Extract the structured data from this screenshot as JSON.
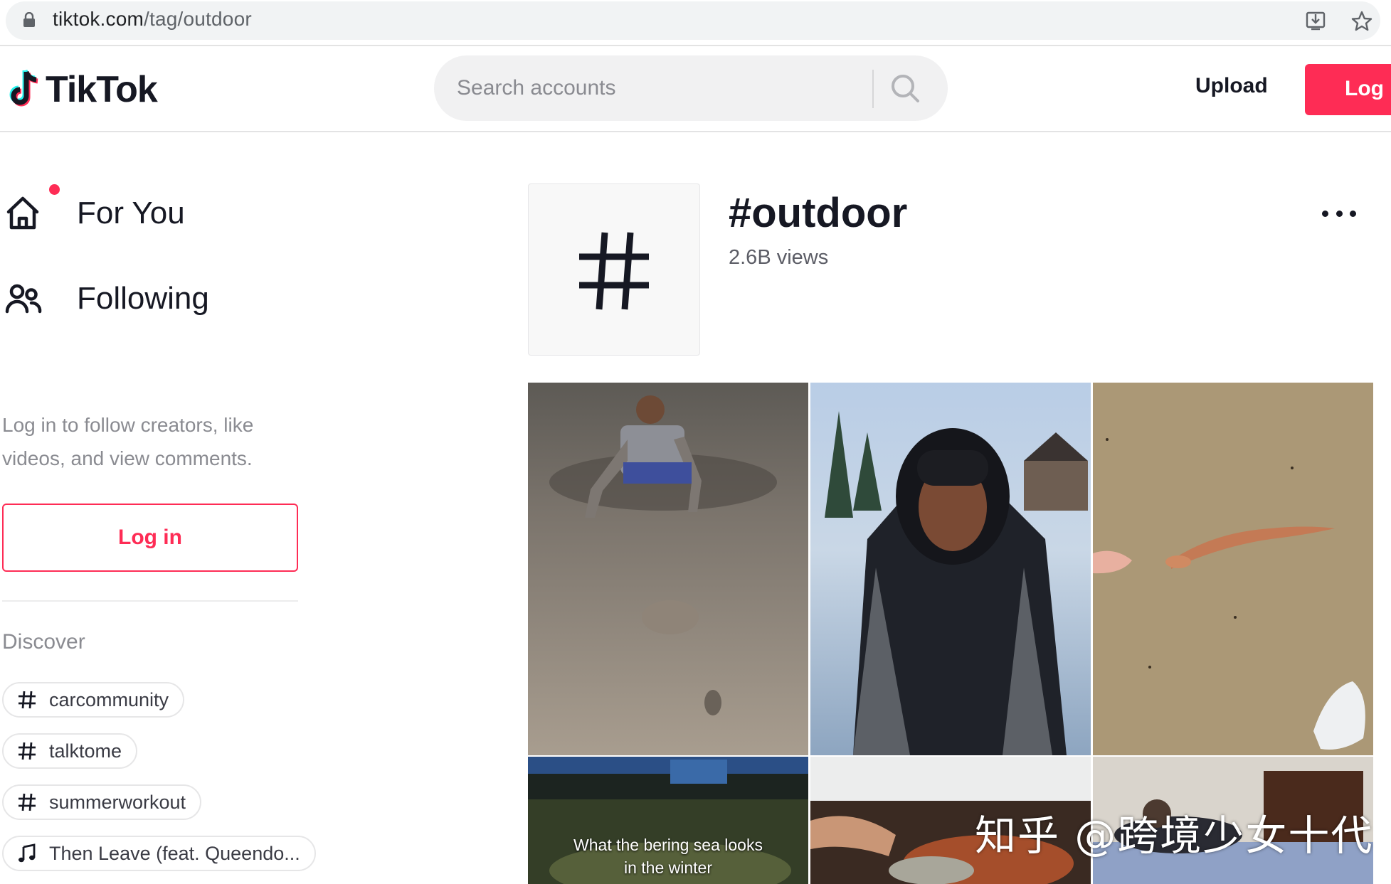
{
  "browser": {
    "url_domain": "tiktok.com",
    "url_path": "/tag/outdoor",
    "icons": [
      "lock-icon",
      "install-icon",
      "star-icon"
    ]
  },
  "header": {
    "logo_text": "TikTok",
    "search_placeholder": "Search accounts",
    "upload_label": "Upload",
    "login_label": "Log in",
    "colors": {
      "brand": "#fe2c55",
      "cyan": "#25f4ee"
    }
  },
  "sidebar": {
    "nav": [
      {
        "label": "For You",
        "icon": "home-icon",
        "has_notification_dot": true
      },
      {
        "label": "Following",
        "icon": "people-icon"
      }
    ],
    "login_prompt": "Log in to follow creators, like videos, and view comments.",
    "login_button": "Log in",
    "discover_title": "Discover",
    "discover_items": [
      {
        "label": "carcommunity",
        "icon": "hashtag-icon"
      },
      {
        "label": "talktome",
        "icon": "hashtag-icon"
      },
      {
        "label": "summerworkout",
        "icon": "hashtag-icon"
      },
      {
        "label": "Then Leave (feat. Queendo...",
        "icon": "music-note-icon"
      }
    ]
  },
  "tag": {
    "title": "#outdoor",
    "views": "2.6B views"
  },
  "videos": [
    {
      "caption": ""
    },
    {
      "caption": ""
    },
    {
      "caption": ""
    },
    {
      "caption_line1": "What the bering sea looks",
      "caption_line2": "in the winter"
    },
    {
      "caption": ""
    },
    {
      "caption": ""
    }
  ],
  "watermark": "知乎 @跨境少女十代"
}
